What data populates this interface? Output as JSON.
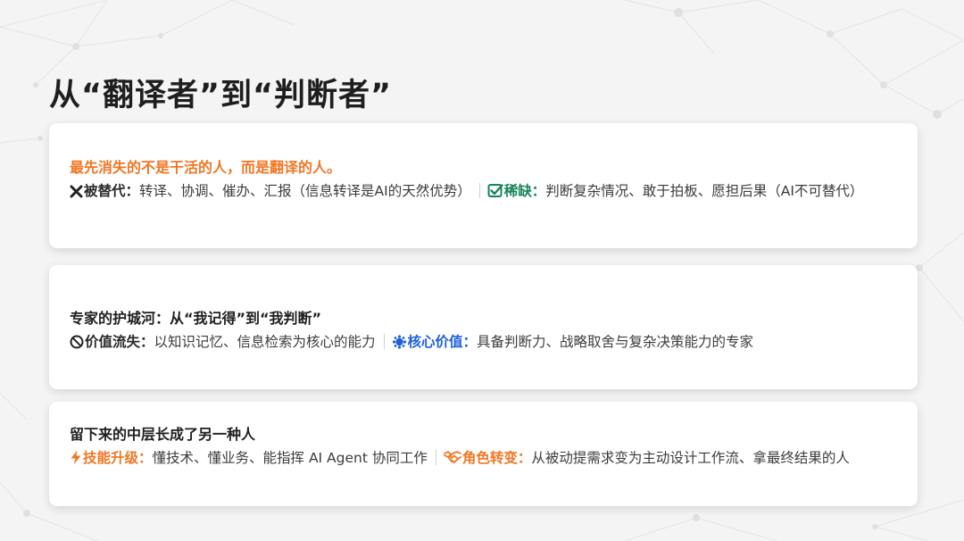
{
  "page": {
    "title": "从“翻译者”到“判断者”"
  },
  "cards": [
    {
      "headline": "最先消失的不是干活的人，而是翻译的人。",
      "left_label": "被替代：",
      "left_text": "转译、协调、催办、汇报（信息转译是AI的天然优势）",
      "right_label": "稀缺：",
      "right_text": "判断复杂情况、敢于拍板、愿担后果（AI不可替代）",
      "left_icon": "cross-icon",
      "right_icon": "checkbox-icon"
    },
    {
      "headline": "专家的护城河：从“我记得”到“我判断”",
      "left_label": "价值流失：",
      "left_text": "以知识记忆、信息检索为核心的能力",
      "right_label": "核心价值：",
      "right_text": "具备判断力、战略取舍与复杂决策能力的专家",
      "left_icon": "ban-icon",
      "right_icon": "brain-icon"
    },
    {
      "headline": "留下来的中层长成了另一种人",
      "left_label": "技能升级：",
      "left_text": "懂技术、懂业务、能指挥 AI Agent 协同工作",
      "right_label": "角色转变：",
      "right_text": "从被动提需求变为主动设计工作流、拿最终结果的人",
      "left_icon": "bolt-icon",
      "right_icon": "handshake-icon"
    }
  ],
  "colors": {
    "accent_orange": "#f07623",
    "accent_green": "#16845a",
    "accent_blue": "#2061d6",
    "title": "#1e1e1e"
  }
}
